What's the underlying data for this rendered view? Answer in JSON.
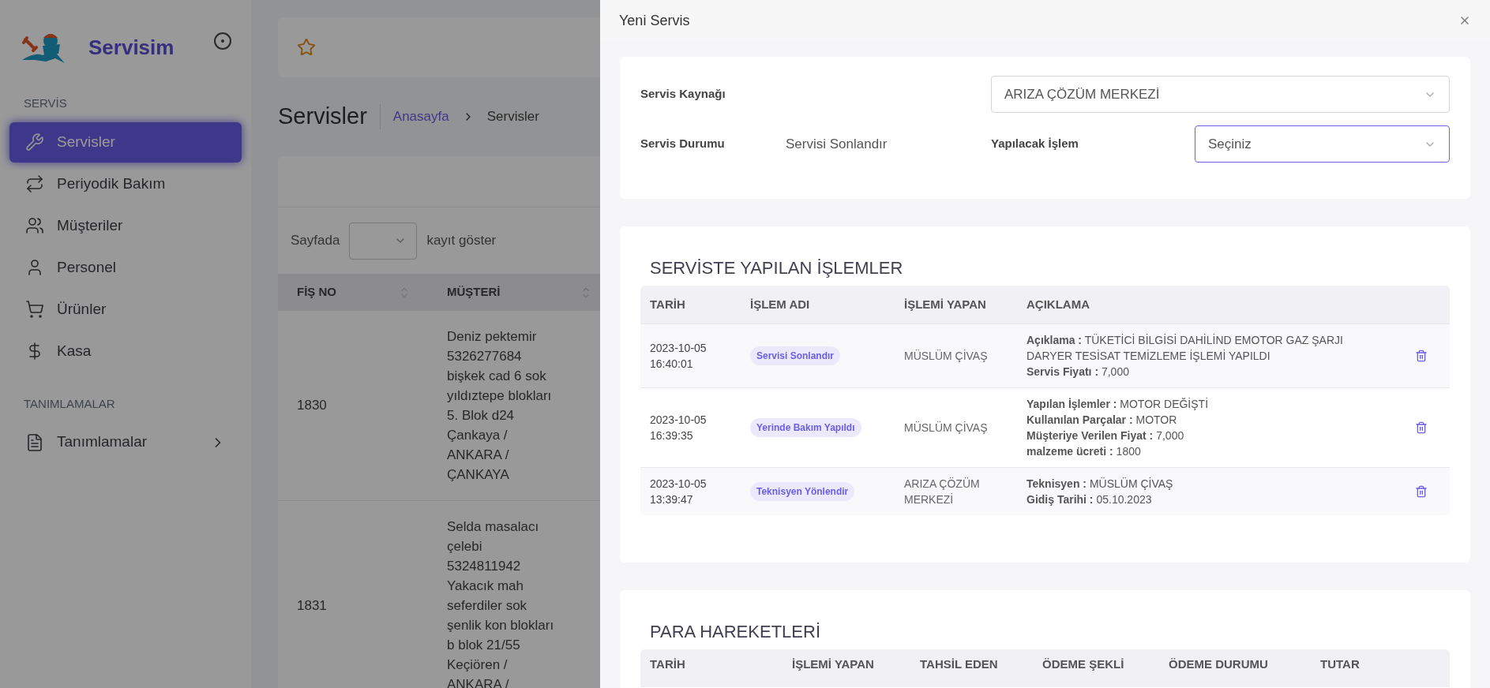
{
  "sidebar": {
    "brand": "Servisim",
    "sections": [
      {
        "title": "SERVİS",
        "items": [
          {
            "label": "Servisler",
            "selected": true
          },
          {
            "label": "Periyodik Bakım",
            "selected": false
          },
          {
            "label": "Müşteriler",
            "selected": false
          },
          {
            "label": "Personel",
            "selected": false
          },
          {
            "label": "Ürünler",
            "selected": false
          },
          {
            "label": "Kasa",
            "selected": false
          }
        ]
      },
      {
        "title": "TANIMLAMALAR",
        "items": [
          {
            "label": "Tanımlamalar",
            "selected": false,
            "expanded": false
          }
        ]
      }
    ]
  },
  "page": {
    "title": "Servisler",
    "breadcrumb": [
      "Anasayfa",
      "Servisler"
    ],
    "table": {
      "length_prefix": "Sayfada",
      "length_suffix": "kayıt göster",
      "columns": [
        "FİŞ NO",
        "MÜŞTERİ"
      ],
      "rows": [
        {
          "fis_no": "1830",
          "musteri": [
            "Deniz pektemir",
            "5326277684",
            "bişkek cad 6 sok",
            "yıldıztepe blokları",
            "5. Blok d24",
            "Çankaya /",
            "ANKARA /",
            "ÇANKAYA"
          ]
        },
        {
          "fis_no": "1831",
          "musteri": [
            "Selda masalacı",
            "çelebi",
            "5324811942",
            "Yakacık mah",
            "seferdiler sok",
            "şenlik kon blokları",
            "b blok 21/55",
            "Keçiören /",
            "ANKARA /"
          ]
        }
      ]
    }
  },
  "modal": {
    "title": "Yeni Servis",
    "form": {
      "source_label": "Servis Kaynağı",
      "source_value": "ARIZA ÇÖZÜM MERKEZİ",
      "status_label": "Servis Durumu",
      "status_value": "Servisi Sonlandır",
      "action_label": "Yapılacak İşlem",
      "action_placeholder": "Seçiniz"
    },
    "operations": {
      "title": "SERVİSTE YAPILAN İŞLEMLER",
      "columns": [
        "TARİH",
        "İŞLEM ADI",
        "İŞLEMİ YAPAN",
        "AÇIKLAMA"
      ],
      "rows": [
        {
          "date": [
            "2023-10-05",
            "16:40:01"
          ],
          "name": "Servisi Sonlandır",
          "by": "MÜSLÜM ÇİVAŞ",
          "details": [
            "**Açıklama :** TÜKETİCİ BİLGİSİ DAHİLİND EMOTOR GAZ ŞARJI DARYER TESİSAT TEMİZLEME İŞLEMİ YAPILDI",
            "**Servis Fiyatı :** 7,000"
          ]
        },
        {
          "date": [
            "2023-10-05",
            "16:39:35"
          ],
          "name": "Yerinde Bakım Yapıldı",
          "by": "MÜSLÜM ÇİVAŞ",
          "details": [
            "**Yapılan İşlemler :** MOTOR DEĞİŞTİ",
            "**Kullanılan Parçalar :** MOTOR",
            "**Müşteriye Verilen Fiyat :** 7,000",
            "**malzeme ücreti :** 1800"
          ]
        },
        {
          "date": [
            "2023-10-05",
            "13:39:47"
          ],
          "name": "Teknisyen Yönlendir",
          "by": "ARIZA ÇÖZÜM MERKEZİ",
          "details": [
            "**Teknisyen :** MÜSLÜM ÇİVAŞ",
            "**Gidiş Tarihi :** 05.10.2023"
          ]
        }
      ]
    },
    "payments": {
      "title": "PARA HAREKETLERİ",
      "columns": [
        "TARİH",
        "İŞLEMİ YAPAN",
        "TAHSİL EDEN",
        "ÖDEME ŞEKLİ",
        "ÖDEME DURUMU",
        "TUTAR"
      ]
    }
  }
}
